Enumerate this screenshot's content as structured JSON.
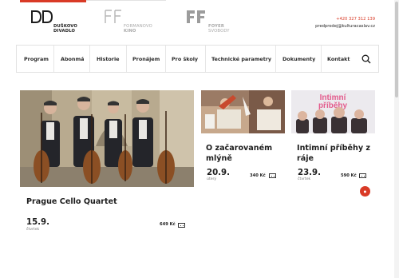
{
  "header": {
    "logos": [
      {
        "line1": "DUŠKOVO",
        "line2": "DIVADLO"
      },
      {
        "line1": "FORMANOVO",
        "line2": "KINO"
      },
      {
        "line1": "FOYER",
        "line2": "SVOBODY"
      }
    ],
    "phone": "+420 327 312 139",
    "email": "predprodej@kulturacaslav.cz"
  },
  "nav": {
    "items": [
      "Program",
      "Abonmá",
      "Historie",
      "Pronájem",
      "Pro školy",
      "Technické parametry",
      "Dokumenty",
      "Kontakt"
    ]
  },
  "events": [
    {
      "title": "Prague Cello Quartet",
      "date": "15.9.",
      "day": "čtvrtek",
      "price": "649 Kč"
    },
    {
      "title": "O začarovaném mlýně",
      "date": "20.9.",
      "day": "úterý",
      "price": "340 Kč"
    },
    {
      "title": "Intimní příběhy z ráje",
      "date": "23.9.",
      "day": "čtvrtek",
      "price": "590 Kč",
      "poster_text": "Intimní příběhy"
    }
  ],
  "colors": {
    "accent": "#d93a26",
    "border": "#e2e2e2"
  },
  "icons": [
    "search-icon",
    "ticket-icon"
  ]
}
